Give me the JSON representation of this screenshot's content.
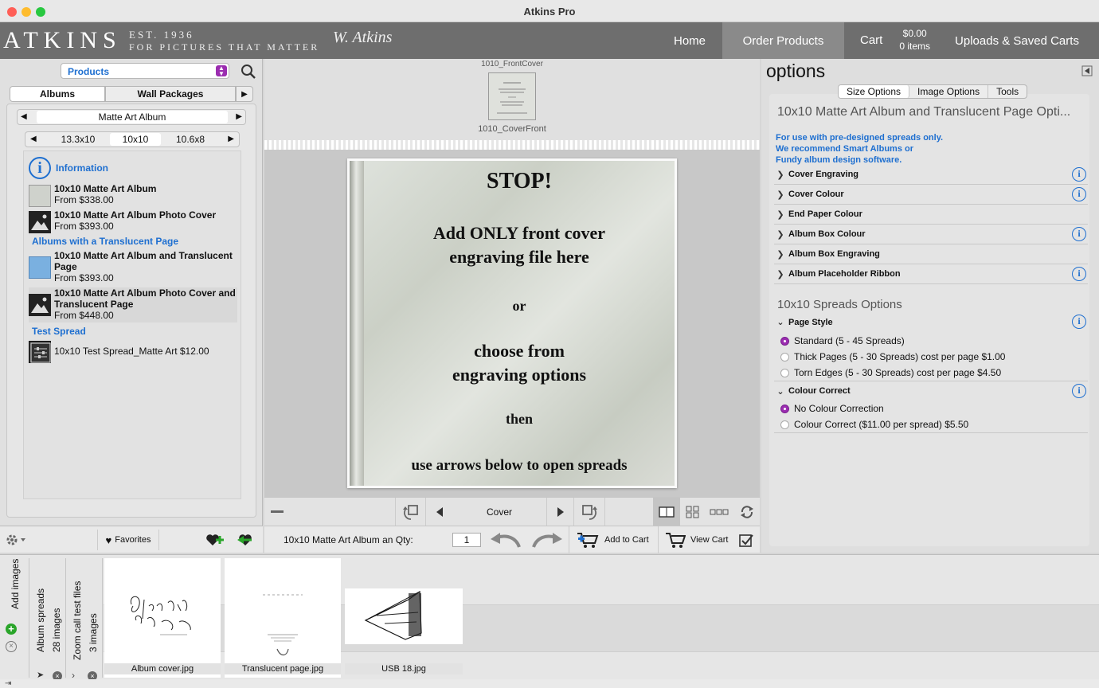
{
  "window": {
    "title": "Atkins Pro"
  },
  "header": {
    "logo": "ATKINS",
    "tagline_est": "EST. 1936",
    "tagline_sub": "FOR PICTURES THAT MATTER",
    "signature": "W. Atkins",
    "nav": {
      "home": "Home",
      "order": "Order Products",
      "cart": "Cart",
      "cart_amount": "$0.00",
      "cart_items": "0 items",
      "uploads": "Uploads & Saved Carts"
    }
  },
  "left": {
    "products_select": "Products",
    "tabs": {
      "albums": "Albums",
      "wall": "Wall Packages"
    },
    "album_type": "Matte Art Album",
    "sizes": [
      "13.3x10",
      "10x10",
      "10.6x8"
    ],
    "info_label": "Information",
    "items": [
      {
        "name": "10x10 Matte Art Album",
        "price": "From $338.00"
      },
      {
        "name": "10x10 Matte Art Album Photo Cover",
        "price": "From $393.00"
      },
      {
        "name": "10x10 Matte Art Album and Translucent Page",
        "price": "From $393.00"
      },
      {
        "name": "10x10 Matte Art Album Photo Cover and Translucent Page",
        "price": "From $448.00"
      },
      {
        "name": "10x10 Test Spread_Matte Art $12.00",
        "price": ""
      }
    ],
    "section_translucent": "Albums with a Translucent Page",
    "section_test": "Test Spread",
    "favorites": "Favorites"
  },
  "center": {
    "strip_top": "1010_FrontCover",
    "strip_bottom": "1010_CoverFront",
    "album_text": {
      "l1": "STOP!",
      "l2": "Add ONLY front cover",
      "l3": "engraving file here",
      "l4": "or",
      "l5": "choose from",
      "l6": "engraving options",
      "l7": "then",
      "l8": "use arrows below to open spreads"
    },
    "page_label": "Cover",
    "qty_label": "10x10 Matte Art Album an Qty:",
    "qty_value": "1",
    "add_to_cart": "Add to Cart",
    "view_cart": "View Cart"
  },
  "right": {
    "title": "options",
    "tabs": [
      "Size Options",
      "Image Options",
      "Tools"
    ],
    "heading": "10x10 Matte Art Album and Translucent Page Opti...",
    "note": [
      "For use with pre-designed spreads only.",
      "We recommend Smart Albums or",
      "Fundy album design software."
    ],
    "rows": [
      {
        "label": "Cover Engraving",
        "info": true
      },
      {
        "label": "Cover Colour",
        "info": true
      },
      {
        "label": "End Paper Colour",
        "info": false
      },
      {
        "label": "Album Box Colour",
        "info": true
      },
      {
        "label": "Album Box Engraving",
        "info": false
      },
      {
        "label": "Album Placeholder Ribbon",
        "info": true
      }
    ],
    "spreads_heading": "10x10 Spreads Options",
    "page_style": "Page Style",
    "page_style_opts": [
      "Standard (5 - 45 Spreads)",
      "Thick Pages (5 - 30 Spreads) cost per page $1.00",
      "Torn Edges (5 - 30 Spreads) cost per page $4.50"
    ],
    "colour_correct": "Colour Correct",
    "colour_opts": [
      "No Colour Correction",
      "Colour Correct ($11.00 per spread) $5.50"
    ]
  },
  "bin": {
    "add_images": "Add images",
    "album_spreads": "Album spreads",
    "album_spreads_count": "28 images",
    "zoom_files": "Zoom call test files",
    "zoom_count": "3 images",
    "thumbs": [
      "Album cover.jpg",
      "Translucent page.jpg",
      "USB 18.jpg"
    ]
  },
  "colors": {
    "accent_blue": "#1e6fd0",
    "radio_purple": "#9b2db0",
    "header_gray": "#6e6e6e"
  }
}
